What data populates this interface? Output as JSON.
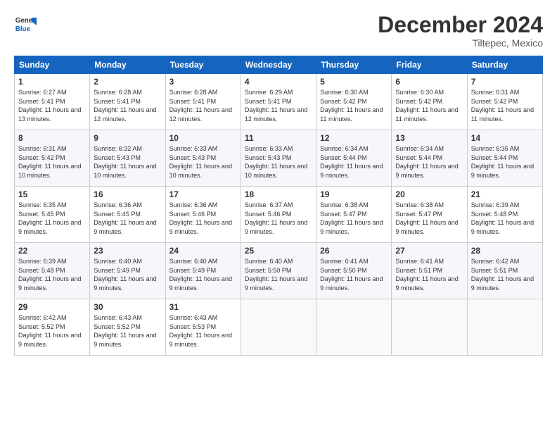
{
  "header": {
    "logo": {
      "general": "General",
      "blue": "Blue"
    },
    "title": "December 2024",
    "location": "Tiltepec, Mexico"
  },
  "weekdays": [
    "Sunday",
    "Monday",
    "Tuesday",
    "Wednesday",
    "Thursday",
    "Friday",
    "Saturday"
  ],
  "weeks": [
    [
      {
        "day": "1",
        "sunrise": "Sunrise: 6:27 AM",
        "sunset": "Sunset: 5:41 PM",
        "daylight": "Daylight: 11 hours and 13 minutes."
      },
      {
        "day": "2",
        "sunrise": "Sunrise: 6:28 AM",
        "sunset": "Sunset: 5:41 PM",
        "daylight": "Daylight: 11 hours and 12 minutes."
      },
      {
        "day": "3",
        "sunrise": "Sunrise: 6:28 AM",
        "sunset": "Sunset: 5:41 PM",
        "daylight": "Daylight: 11 hours and 12 minutes."
      },
      {
        "day": "4",
        "sunrise": "Sunrise: 6:29 AM",
        "sunset": "Sunset: 5:41 PM",
        "daylight": "Daylight: 11 hours and 12 minutes."
      },
      {
        "day": "5",
        "sunrise": "Sunrise: 6:30 AM",
        "sunset": "Sunset: 5:42 PM",
        "daylight": "Daylight: 11 hours and 11 minutes."
      },
      {
        "day": "6",
        "sunrise": "Sunrise: 6:30 AM",
        "sunset": "Sunset: 5:42 PM",
        "daylight": "Daylight: 11 hours and 11 minutes."
      },
      {
        "day": "7",
        "sunrise": "Sunrise: 6:31 AM",
        "sunset": "Sunset: 5:42 PM",
        "daylight": "Daylight: 11 hours and 11 minutes."
      }
    ],
    [
      {
        "day": "8",
        "sunrise": "Sunrise: 6:31 AM",
        "sunset": "Sunset: 5:42 PM",
        "daylight": "Daylight: 11 hours and 10 minutes."
      },
      {
        "day": "9",
        "sunrise": "Sunrise: 6:32 AM",
        "sunset": "Sunset: 5:43 PM",
        "daylight": "Daylight: 11 hours and 10 minutes."
      },
      {
        "day": "10",
        "sunrise": "Sunrise: 6:33 AM",
        "sunset": "Sunset: 5:43 PM",
        "daylight": "Daylight: 11 hours and 10 minutes."
      },
      {
        "day": "11",
        "sunrise": "Sunrise: 6:33 AM",
        "sunset": "Sunset: 5:43 PM",
        "daylight": "Daylight: 11 hours and 10 minutes."
      },
      {
        "day": "12",
        "sunrise": "Sunrise: 6:34 AM",
        "sunset": "Sunset: 5:44 PM",
        "daylight": "Daylight: 11 hours and 9 minutes."
      },
      {
        "day": "13",
        "sunrise": "Sunrise: 6:34 AM",
        "sunset": "Sunset: 5:44 PM",
        "daylight": "Daylight: 11 hours and 9 minutes."
      },
      {
        "day": "14",
        "sunrise": "Sunrise: 6:35 AM",
        "sunset": "Sunset: 5:44 PM",
        "daylight": "Daylight: 11 hours and 9 minutes."
      }
    ],
    [
      {
        "day": "15",
        "sunrise": "Sunrise: 6:35 AM",
        "sunset": "Sunset: 5:45 PM",
        "daylight": "Daylight: 11 hours and 9 minutes."
      },
      {
        "day": "16",
        "sunrise": "Sunrise: 6:36 AM",
        "sunset": "Sunset: 5:45 PM",
        "daylight": "Daylight: 11 hours and 9 minutes."
      },
      {
        "day": "17",
        "sunrise": "Sunrise: 6:36 AM",
        "sunset": "Sunset: 5:46 PM",
        "daylight": "Daylight: 11 hours and 9 minutes."
      },
      {
        "day": "18",
        "sunrise": "Sunrise: 6:37 AM",
        "sunset": "Sunset: 5:46 PM",
        "daylight": "Daylight: 11 hours and 9 minutes."
      },
      {
        "day": "19",
        "sunrise": "Sunrise: 6:38 AM",
        "sunset": "Sunset: 5:47 PM",
        "daylight": "Daylight: 11 hours and 9 minutes."
      },
      {
        "day": "20",
        "sunrise": "Sunrise: 6:38 AM",
        "sunset": "Sunset: 5:47 PM",
        "daylight": "Daylight: 11 hours and 9 minutes."
      },
      {
        "day": "21",
        "sunrise": "Sunrise: 6:39 AM",
        "sunset": "Sunset: 5:48 PM",
        "daylight": "Daylight: 11 hours and 9 minutes."
      }
    ],
    [
      {
        "day": "22",
        "sunrise": "Sunrise: 6:39 AM",
        "sunset": "Sunset: 5:48 PM",
        "daylight": "Daylight: 11 hours and 9 minutes."
      },
      {
        "day": "23",
        "sunrise": "Sunrise: 6:40 AM",
        "sunset": "Sunset: 5:49 PM",
        "daylight": "Daylight: 11 hours and 9 minutes."
      },
      {
        "day": "24",
        "sunrise": "Sunrise: 6:40 AM",
        "sunset": "Sunset: 5:49 PM",
        "daylight": "Daylight: 11 hours and 9 minutes."
      },
      {
        "day": "25",
        "sunrise": "Sunrise: 6:40 AM",
        "sunset": "Sunset: 5:50 PM",
        "daylight": "Daylight: 11 hours and 9 minutes."
      },
      {
        "day": "26",
        "sunrise": "Sunrise: 6:41 AM",
        "sunset": "Sunset: 5:50 PM",
        "daylight": "Daylight: 11 hours and 9 minutes."
      },
      {
        "day": "27",
        "sunrise": "Sunrise: 6:41 AM",
        "sunset": "Sunset: 5:51 PM",
        "daylight": "Daylight: 11 hours and 9 minutes."
      },
      {
        "day": "28",
        "sunrise": "Sunrise: 6:42 AM",
        "sunset": "Sunset: 5:51 PM",
        "daylight": "Daylight: 11 hours and 9 minutes."
      }
    ],
    [
      {
        "day": "29",
        "sunrise": "Sunrise: 6:42 AM",
        "sunset": "Sunset: 5:52 PM",
        "daylight": "Daylight: 11 hours and 9 minutes."
      },
      {
        "day": "30",
        "sunrise": "Sunrise: 6:43 AM",
        "sunset": "Sunset: 5:52 PM",
        "daylight": "Daylight: 11 hours and 9 minutes."
      },
      {
        "day": "31",
        "sunrise": "Sunrise: 6:43 AM",
        "sunset": "Sunset: 5:53 PM",
        "daylight": "Daylight: 11 hours and 9 minutes."
      },
      null,
      null,
      null,
      null
    ]
  ]
}
